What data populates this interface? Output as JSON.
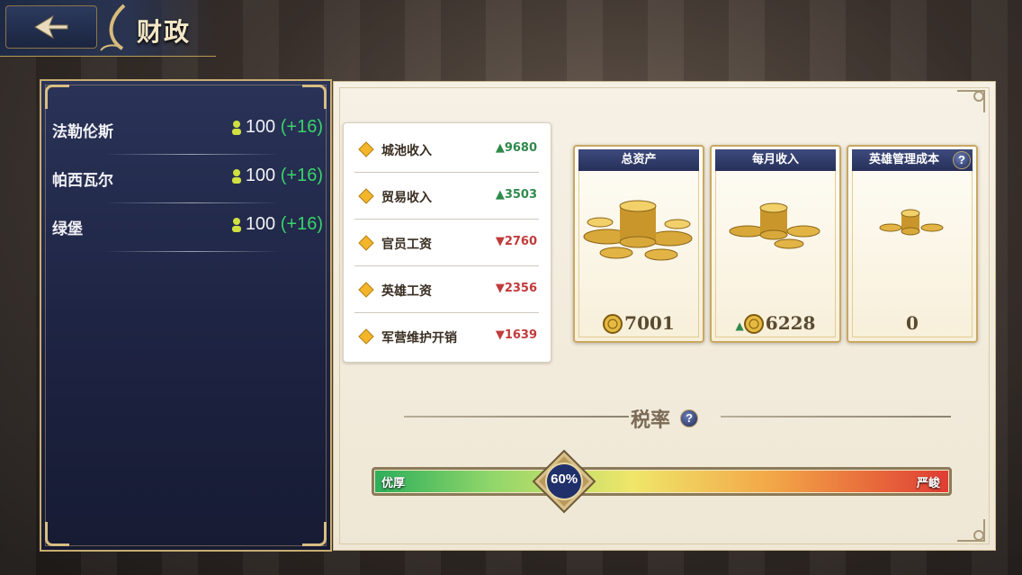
{
  "header": {
    "title": "财政",
    "back_icon": "back-arrow-icon"
  },
  "cities": [
    {
      "name": "法勒伦斯",
      "population": "100",
      "change": "(+16)"
    },
    {
      "name": "帕西瓦尔",
      "population": "100",
      "change": "(+16)"
    },
    {
      "name": "绿堡",
      "population": "100",
      "change": "(+16)"
    }
  ],
  "income": [
    {
      "label": "城池收入",
      "value": "9680",
      "trend": "up"
    },
    {
      "label": "贸易收入",
      "value": "3503",
      "trend": "up"
    },
    {
      "label": "官员工资",
      "value": "2760",
      "trend": "down"
    },
    {
      "label": "英雄工资",
      "value": "2356",
      "trend": "down"
    },
    {
      "label": "军营维护开销",
      "value": "1639",
      "trend": "down"
    }
  ],
  "cards": {
    "total_assets": {
      "title": "总资产",
      "value": "7001"
    },
    "monthly_income": {
      "title": "每月收入",
      "value": "6228"
    },
    "hero_cost": {
      "title": "英雄管理成本",
      "value": "0"
    }
  },
  "tax": {
    "title": "税率",
    "percent": 60,
    "percent_label": "60%",
    "low_label": "优厚",
    "high_label": "严峻"
  },
  "colors": {
    "gain": "#39d46a",
    "loss": "#c23b3b",
    "gold": "#c9a862",
    "navy": "#1c2240"
  }
}
